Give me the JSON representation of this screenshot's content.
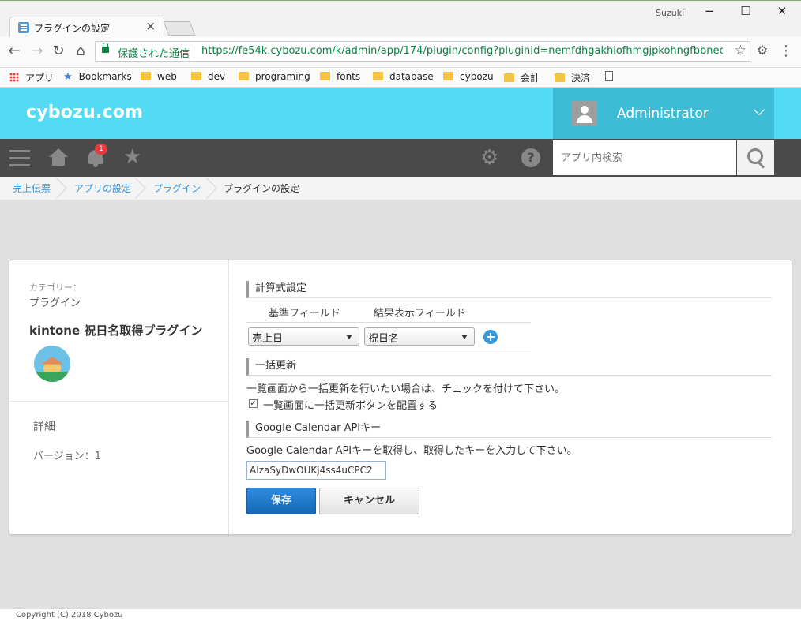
{
  "browser": {
    "tab_title": "プラグインの設定",
    "window_user": "Suzuki",
    "secure_label": "保護された通信",
    "url": "https://fe54k.cybozu.com/k/admin/app/174/plugin/config?pluginId=nemfdhgakhlofhmgjpkohngfbbnecc..."
  },
  "bookmarks": [
    "アプリ",
    "Bookmarks",
    "web",
    "dev",
    "programing",
    "fonts",
    "database",
    "cybozu",
    "会計",
    "決済"
  ],
  "header": {
    "logo": "cybozu.com",
    "user_name": "Administrator"
  },
  "nav": {
    "notification_count": "1",
    "search_placeholder": "アプリ内検索"
  },
  "breadcrumb": [
    "売上伝票",
    "アプリの設定",
    "プラグイン",
    "プラグインの設定"
  ],
  "plugin": {
    "category_label": "カテゴリー：",
    "category_value": "プラグイン",
    "name": "kintone 祝日名取得プラグイン",
    "detail_label": "詳細",
    "version_label": "バージョン：1"
  },
  "config": {
    "section1_title": "計算式設定",
    "col_base": "基準フィールド",
    "col_result": "結果表示フィールド",
    "base_value": "売上日",
    "result_value": "祝日名",
    "section2_title": "一括更新",
    "bulk_desc": "一覧画面から一括更新を行いたい場合は、チェックを付けて下さい。",
    "bulk_checkbox_label": "一覧画面に一括更新ボタンを配置する",
    "bulk_checked": true,
    "section3_title": "Google Calendar APIキー",
    "api_desc": "Google Calendar APIキーを取得し、取得したキーを入力して下さい。",
    "api_value": "AIzaSyDwOUKj4ss4uCPC2",
    "save_label": "保存",
    "cancel_label": "キャンセル"
  },
  "footer": {
    "copyright": "Copyright (C) 2018 Cybozu"
  },
  "colors": {
    "header_bg": "#53dbf3",
    "user_bg": "#3fbcd5",
    "nav_bg": "#4a4a4a",
    "link": "#3498db",
    "save_button": "#1f78cf"
  }
}
